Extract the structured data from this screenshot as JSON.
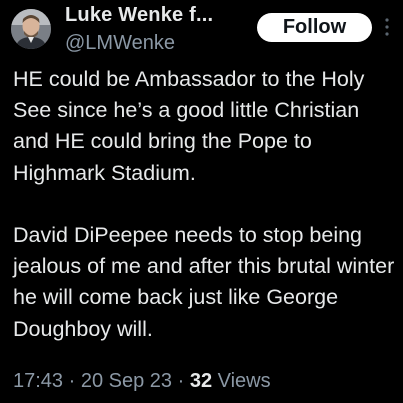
{
  "author": {
    "display_name": "Luke Wenke f...",
    "handle": "@LMWenke",
    "avatar_icon": "profile-photo"
  },
  "actions": {
    "follow_label": "Follow",
    "more_icon": "more-options-icon"
  },
  "tweet": {
    "paragraphs": [
      "HE could be Ambassador to the Holy See since he’s a good little Christian and HE could bring the Pope to Highmark Stadium.",
      "David DiPeepee needs to stop being jealous of me and after this brutal winter he will come back just like George Doughboy will."
    ]
  },
  "meta": {
    "time": "17:43",
    "separator1": " · ",
    "date": "20 Sep 23",
    "separator2": " · ",
    "view_count": "32",
    "views_label": " Views"
  },
  "colors": {
    "background": "#000000",
    "text_primary": "#e7e9ea",
    "text_secondary": "#8b98a5",
    "follow_bg": "#ffffff"
  }
}
